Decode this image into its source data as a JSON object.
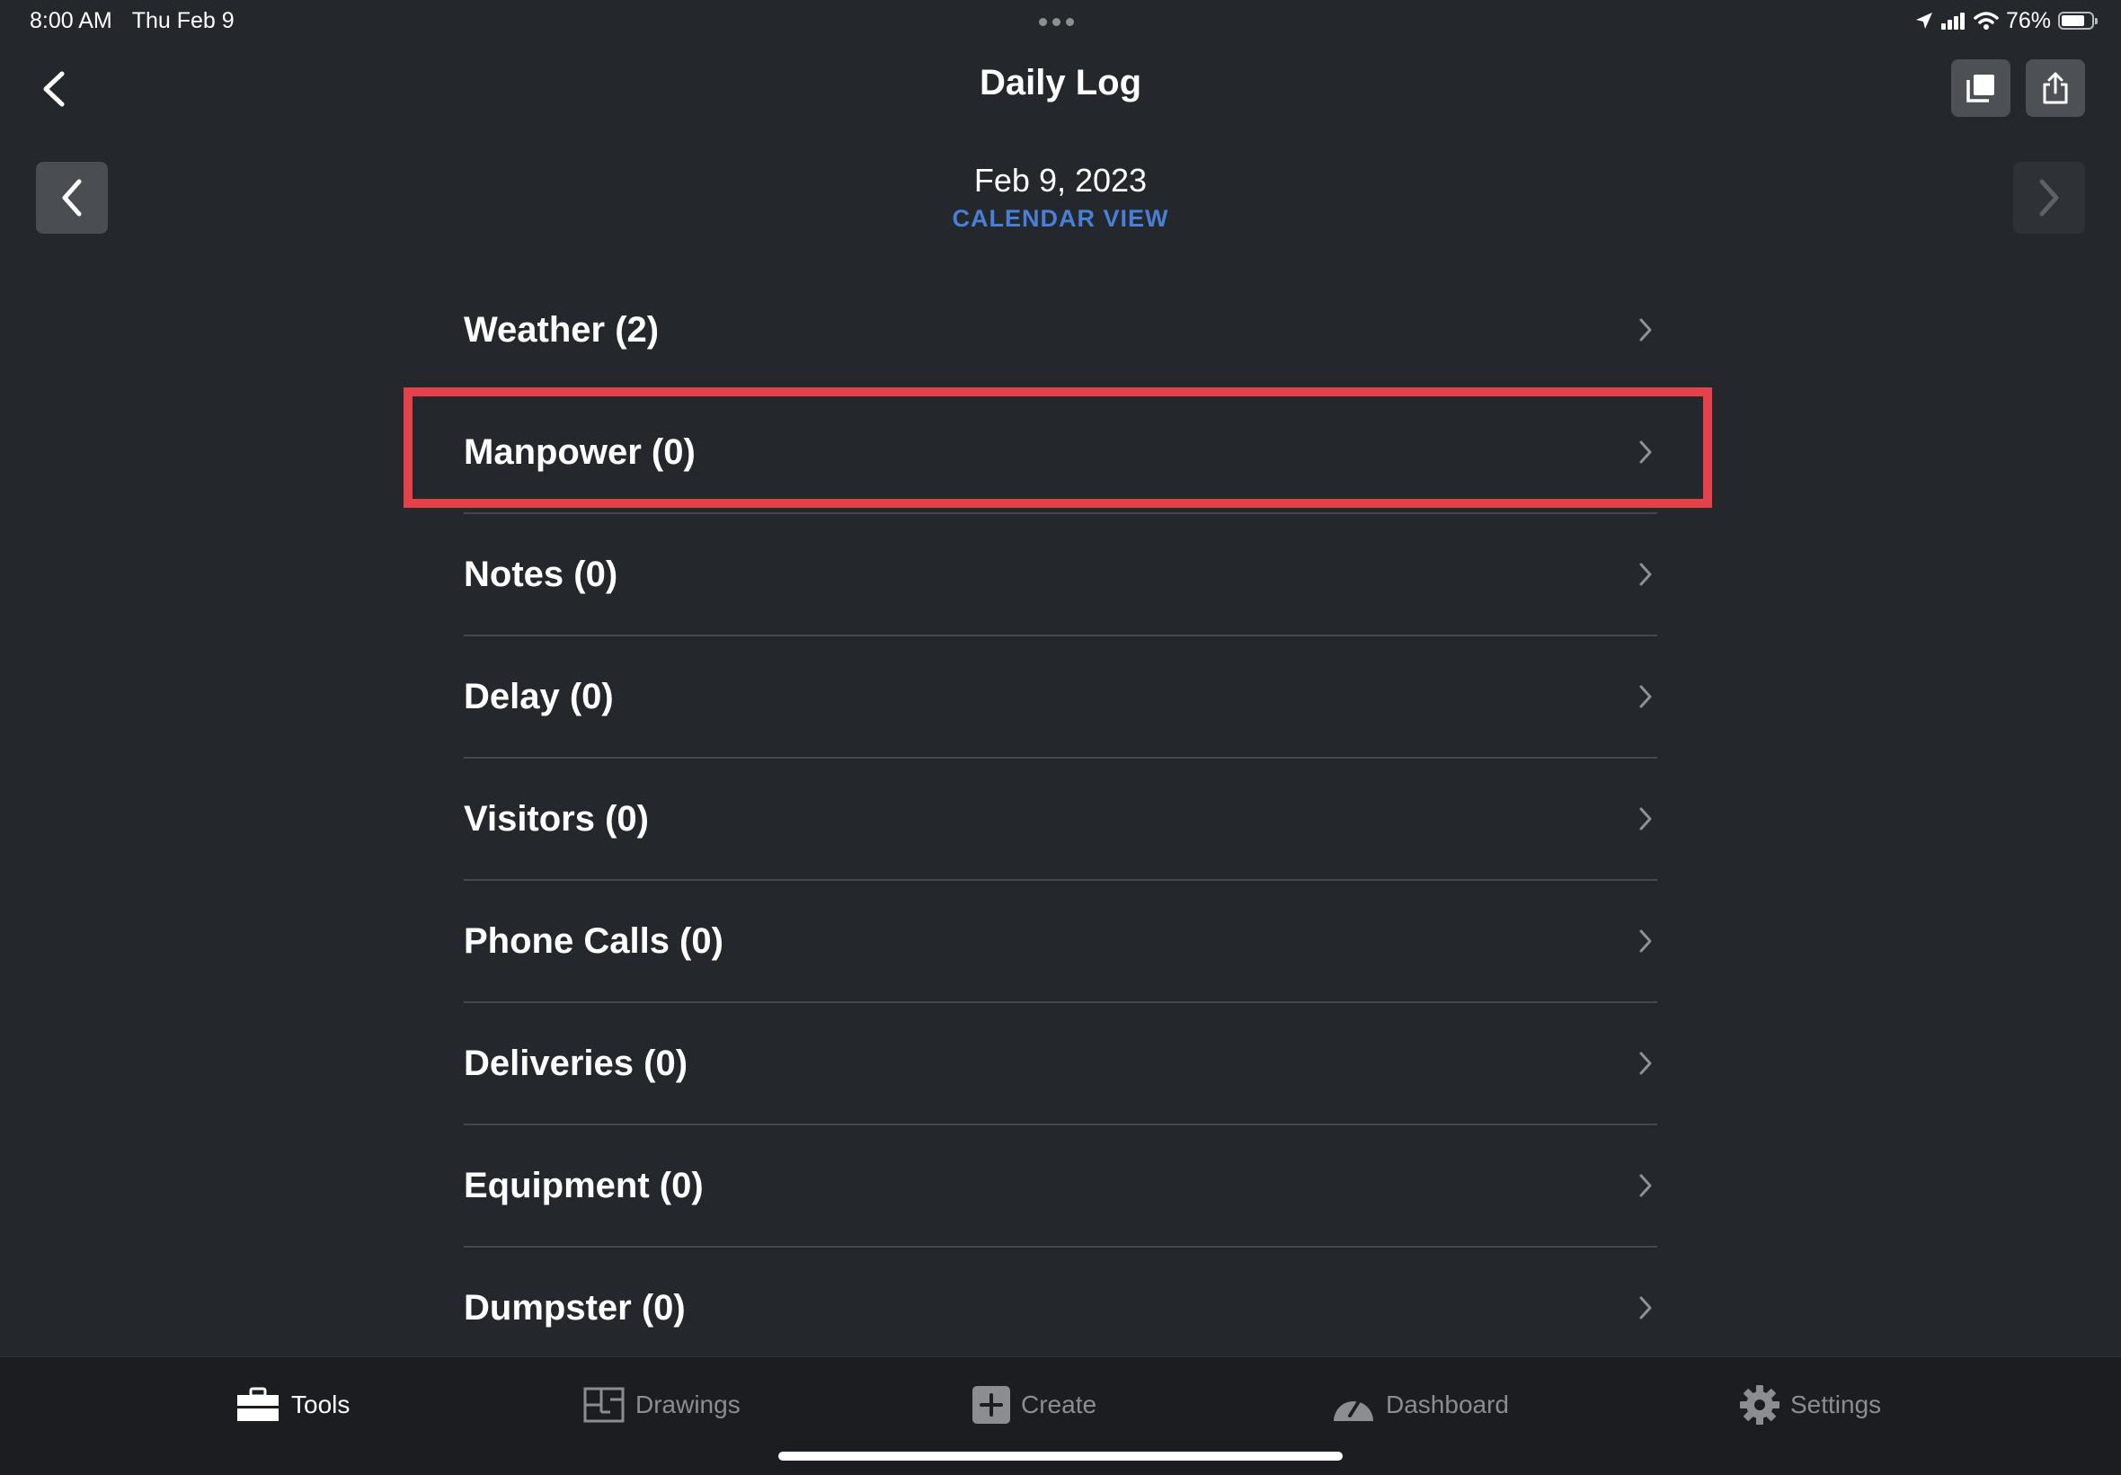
{
  "status_bar": {
    "time": "8:00 AM",
    "date": "Thu Feb 9",
    "battery": "76%",
    "battery_level": 0.76
  },
  "header": {
    "title": "Daily Log",
    "back_icon": "chevron-left-icon",
    "actions": [
      {
        "name": "copy-icon"
      },
      {
        "name": "share-icon"
      }
    ]
  },
  "date_nav": {
    "date": "Feb 9, 2023",
    "calendar_link": "CALENDAR VIEW",
    "calendar_link_color": "#4a7fd6"
  },
  "log_sections": [
    {
      "label": "Weather (2)"
    },
    {
      "label": "Manpower (0)"
    },
    {
      "label": "Notes (0)"
    },
    {
      "label": "Delay (0)"
    },
    {
      "label": "Visitors (0)"
    },
    {
      "label": "Phone Calls (0)"
    },
    {
      "label": "Deliveries (0)"
    },
    {
      "label": "Equipment (0)"
    },
    {
      "label": "Dumpster (0)"
    }
  ],
  "highlight": {
    "target": "Manpower (0)",
    "color": "#e5414b"
  },
  "tab_bar": {
    "tabs": [
      {
        "label": "Tools",
        "icon": "toolbox-icon",
        "active": true
      },
      {
        "label": "Drawings",
        "icon": "floorplan-icon",
        "active": false
      },
      {
        "label": "Create",
        "icon": "plus-square-icon",
        "active": false
      },
      {
        "label": "Dashboard",
        "icon": "gauge-icon",
        "active": false
      },
      {
        "label": "Settings",
        "icon": "gear-icon",
        "active": false
      }
    ]
  },
  "colors": {
    "background": "#24272b",
    "tab_bar": "#1b1d20",
    "divider": "#45484d"
  }
}
